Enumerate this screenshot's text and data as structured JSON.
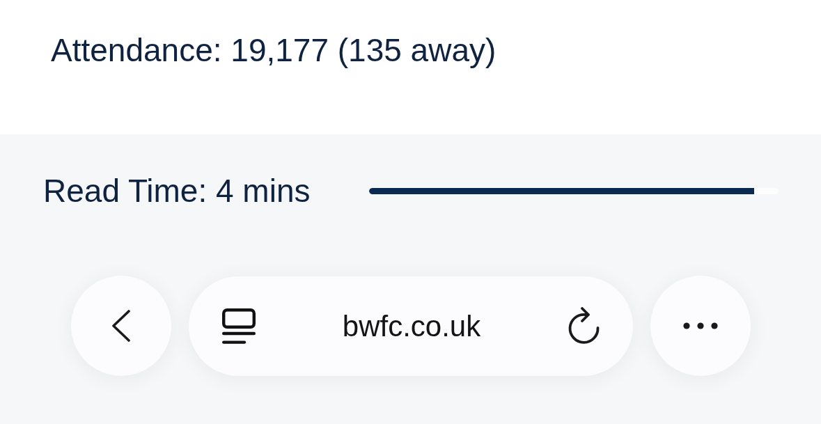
{
  "article": {
    "attendance": "Attendance: 19,177 (135 away)"
  },
  "read_time": {
    "label": "Read Time: 4 mins",
    "level": 0.94
  },
  "browser_toolbar": {
    "url": "bwfc.co.uk"
  }
}
